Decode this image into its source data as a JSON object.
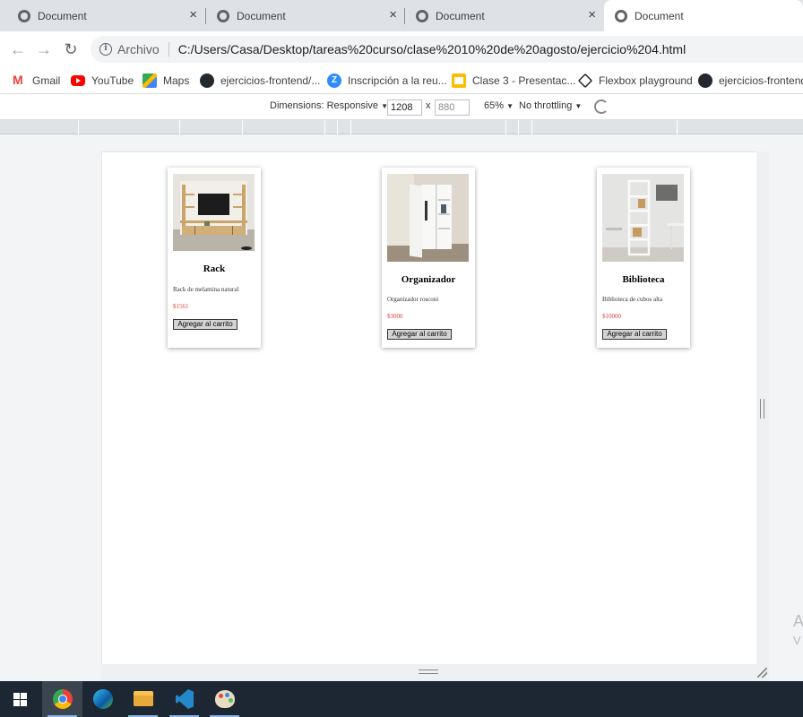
{
  "browser": {
    "tabs": [
      {
        "title": "Document",
        "active": false
      },
      {
        "title": "Document",
        "active": false
      },
      {
        "title": "Document",
        "active": false
      },
      {
        "title": "Document",
        "active": true
      }
    ],
    "close_glyph": "×",
    "omnibox": {
      "scheme_label": "Archivo",
      "url": "C:/Users/Casa/Desktop/tareas%20curso/clase%2010%20de%20agosto/ejercicio%204.html"
    },
    "nav": {
      "back": "←",
      "forward": "→",
      "reload": "↻",
      "info": "i"
    }
  },
  "bookmarks": [
    {
      "label": "Gmail",
      "icon": "gmail-icon"
    },
    {
      "label": "YouTube",
      "icon": "youtube-icon"
    },
    {
      "label": "Maps",
      "icon": "maps-icon"
    },
    {
      "label": "ejercicios-frontend/...",
      "icon": "github-icon"
    },
    {
      "label": "Inscripción a la reu...",
      "icon": "zoom-icon"
    },
    {
      "label": "Clase 3 - Presentac...",
      "icon": "slides-icon"
    },
    {
      "label": "Flexbox playground",
      "icon": "codepen-icon"
    },
    {
      "label": "ejercicios-frontend",
      "icon": "github-icon"
    }
  ],
  "devtools": {
    "dimensions_label": "Dimensions: Responsive",
    "width": "1208",
    "times": "x",
    "height": "880",
    "zoom": "65%",
    "throttling": "No throttling",
    "caret": "▼"
  },
  "products": [
    {
      "title": "Rack",
      "description": "Rack de melamina natural",
      "price": "$1561",
      "button": "Agregar al carrito",
      "image": "tv-rack-photo"
    },
    {
      "title": "Organizador",
      "description": "Organizador rosconi",
      "price": "$3000",
      "button": "Agregar al carrito",
      "image": "organizer-cabinet-photo"
    },
    {
      "title": "Biblioteca",
      "description": "Biblioteca de cubos alta",
      "price": "$10000",
      "button": "Agregar al carrito",
      "image": "cube-bookcase-photo"
    }
  ],
  "watermark": {
    "line1": "A",
    "line2": "V"
  },
  "taskbar": [
    "windows-start-icon",
    "chrome-icon",
    "edge-icon",
    "file-explorer-icon",
    "vscode-icon",
    "paint-icon"
  ],
  "colors": {
    "price": "#e04040",
    "tab_strip": "#dee1e6",
    "taskbar": "#1c2733"
  }
}
